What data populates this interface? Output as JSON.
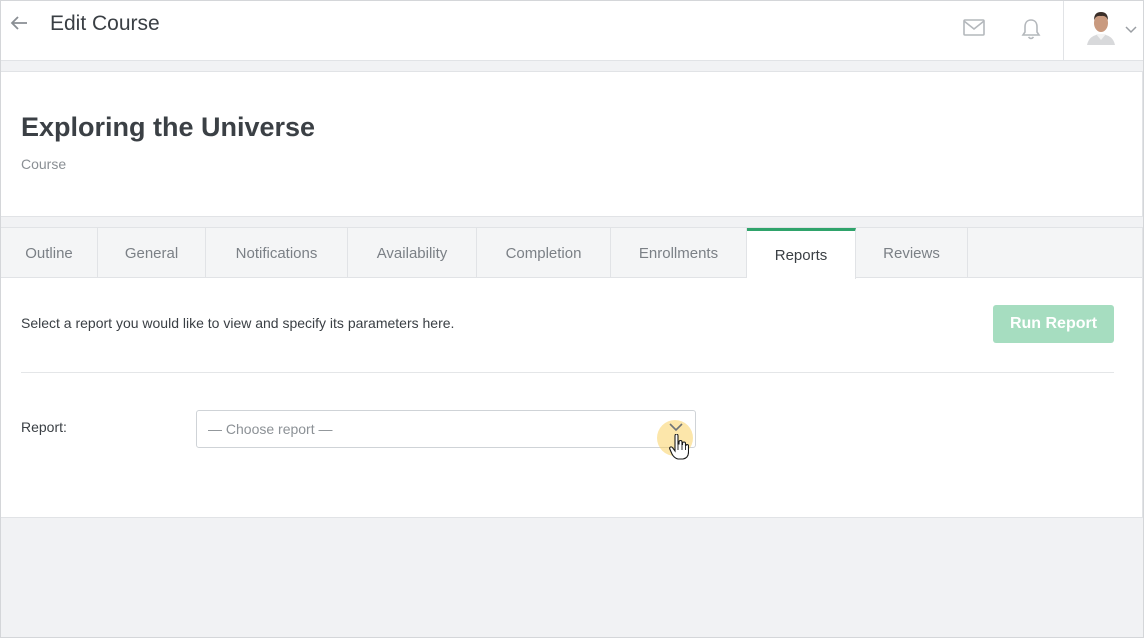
{
  "header": {
    "title": "Edit Course",
    "back_icon": "arrow-left-icon",
    "mail_icon": "mail-icon",
    "bell_icon": "bell-icon",
    "avatar_icon": "user-avatar",
    "chevron_icon": "chevron-down-icon"
  },
  "course": {
    "title": "Exploring the Universe",
    "subtitle": "Course"
  },
  "tabs": [
    {
      "label": "Outline"
    },
    {
      "label": "General"
    },
    {
      "label": "Notifications"
    },
    {
      "label": "Availability"
    },
    {
      "label": "Completion"
    },
    {
      "label": "Enrollments"
    },
    {
      "label": "Reports",
      "active": true
    },
    {
      "label": "Reviews"
    }
  ],
  "reports": {
    "intro": "Select a report you would like to view and specify its parameters here.",
    "run_label": "Run Report",
    "report_label": "Report:",
    "select_placeholder": "— Choose report —"
  },
  "colors": {
    "accent": "#2fa36b",
    "button_disabled": "#a6ddc0"
  }
}
